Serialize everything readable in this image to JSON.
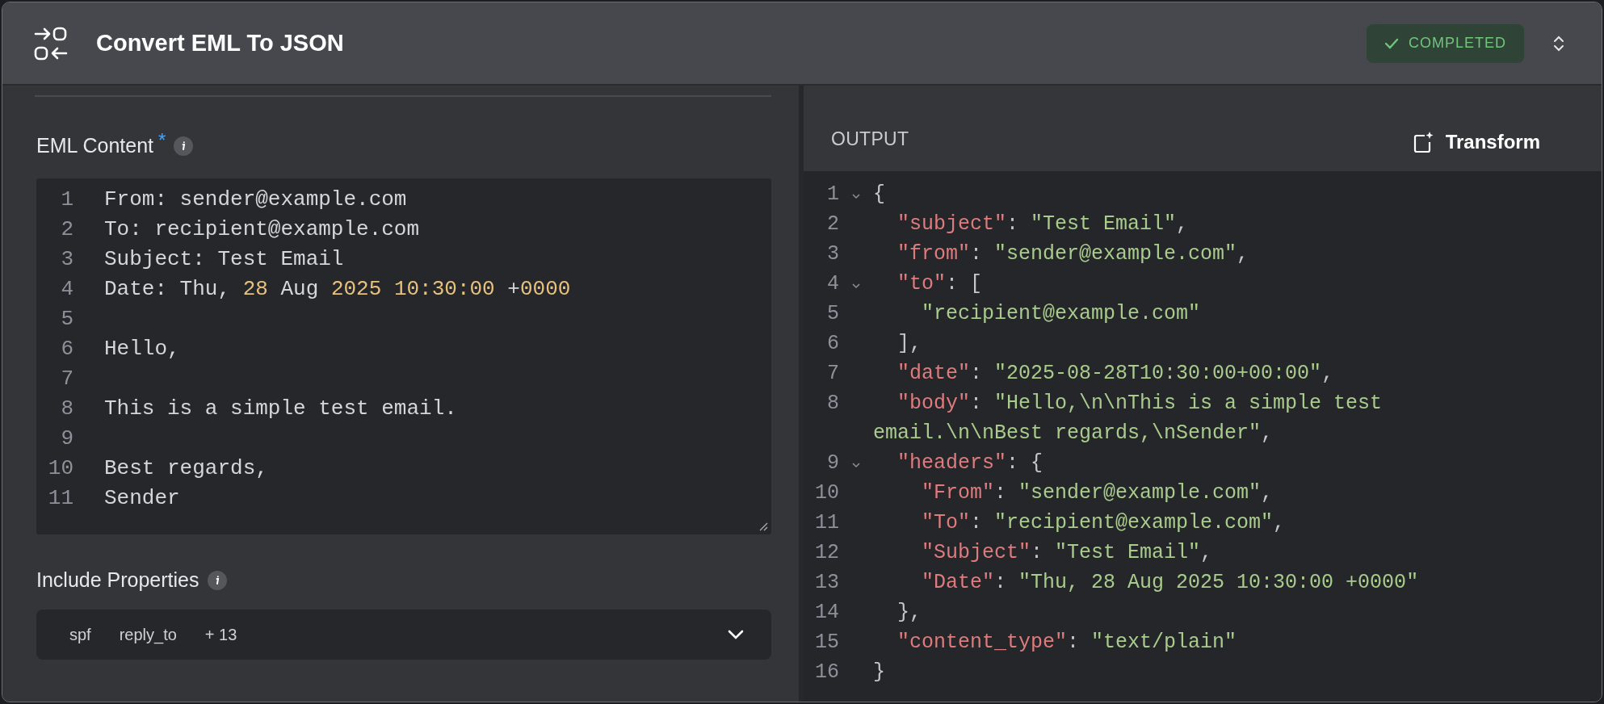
{
  "header": {
    "title": "Convert EML To JSON",
    "status": {
      "label": "COMPLETED"
    }
  },
  "input_panel": {
    "fields": [
      {
        "kind": "code",
        "label": "EML Content",
        "required_mark": "*",
        "lines": [
          {
            "number": "1",
            "segments": [
              {
                "kind": "plain",
                "text": "From: sender@example.com"
              }
            ]
          },
          {
            "number": "2",
            "segments": [
              {
                "kind": "plain",
                "text": "To: recipient@example.com"
              }
            ]
          },
          {
            "number": "3",
            "segments": [
              {
                "kind": "plain",
                "text": "Subject: Test Email"
              }
            ]
          },
          {
            "number": "4",
            "segments": [
              {
                "kind": "plain",
                "text": "Date: Thu, "
              },
              {
                "kind": "number",
                "text": "28"
              },
              {
                "kind": "plain",
                "text": " Aug "
              },
              {
                "kind": "number",
                "text": "2025 10:30:00"
              },
              {
                "kind": "plain",
                "text": " +"
              },
              {
                "kind": "number",
                "text": "0000"
              }
            ]
          },
          {
            "number": "5"
          },
          {
            "number": "6",
            "segments": [
              {
                "kind": "plain",
                "text": "Hello,"
              }
            ]
          },
          {
            "number": "7"
          },
          {
            "number": "8",
            "segments": [
              {
                "kind": "plain",
                "text": "This is a simple test email."
              }
            ]
          },
          {
            "number": "9"
          },
          {
            "number": "10",
            "segments": [
              {
                "kind": "plain",
                "text": "Best regards,"
              }
            ]
          },
          {
            "number": "11",
            "segments": [
              {
                "kind": "plain",
                "text": "Sender"
              }
            ]
          }
        ]
      },
      {
        "kind": "multiselect",
        "label": "Include Properties",
        "chips": [
          "spf",
          "reply_to"
        ],
        "more": "+ 13"
      }
    ]
  },
  "output_panel": {
    "title": "OUTPUT",
    "action": "Transform",
    "lines": [
      {
        "number": "1",
        "foldable": true,
        "segments": [
          {
            "kind": "punct",
            "text": "{"
          }
        ]
      },
      {
        "number": "2",
        "foldable": false,
        "segments": [
          {
            "kind": "key",
            "text": "  \"subject\""
          },
          {
            "kind": "punct",
            "text": ": "
          },
          {
            "kind": "string",
            "text": "\"Test Email\""
          },
          {
            "kind": "punct",
            "text": ","
          }
        ]
      },
      {
        "number": "3",
        "foldable": false,
        "segments": [
          {
            "kind": "key",
            "text": "  \"from\""
          },
          {
            "kind": "punct",
            "text": ": "
          },
          {
            "kind": "string",
            "text": "\"sender@example.com\""
          },
          {
            "kind": "punct",
            "text": ","
          }
        ]
      },
      {
        "number": "4",
        "foldable": true,
        "segments": [
          {
            "kind": "key",
            "text": "  \"to\""
          },
          {
            "kind": "punct",
            "text": ": ["
          }
        ]
      },
      {
        "number": "5",
        "foldable": false,
        "segments": [
          {
            "kind": "string",
            "text": "    \"recipient@example.com\""
          }
        ]
      },
      {
        "number": "6",
        "foldable": false,
        "segments": [
          {
            "kind": "punct",
            "text": "  ],"
          }
        ]
      },
      {
        "number": "7",
        "foldable": false,
        "segments": [
          {
            "kind": "key",
            "text": "  \"date\""
          },
          {
            "kind": "punct",
            "text": ": "
          },
          {
            "kind": "string",
            "text": "\"2025-08-28T10:30:00+00:00\""
          },
          {
            "kind": "punct",
            "text": ","
          }
        ]
      },
      {
        "number": "8",
        "foldable": false,
        "segments": [
          {
            "kind": "key",
            "text": "  \"body\""
          },
          {
            "kind": "punct",
            "text": ": "
          },
          {
            "kind": "string",
            "text": "\"Hello,\\n\\nThis is a simple test email.\\n\\nBest regards,\\nSender\""
          },
          {
            "kind": "punct",
            "text": ","
          }
        ]
      },
      {
        "number": "9",
        "foldable": true,
        "segments": [
          {
            "kind": "key",
            "text": "  \"headers\""
          },
          {
            "kind": "punct",
            "text": ": {"
          }
        ]
      },
      {
        "number": "10",
        "foldable": false,
        "segments": [
          {
            "kind": "key",
            "text": "    \"From\""
          },
          {
            "kind": "punct",
            "text": ": "
          },
          {
            "kind": "string",
            "text": "\"sender@example.com\""
          },
          {
            "kind": "punct",
            "text": ","
          }
        ]
      },
      {
        "number": "11",
        "foldable": false,
        "segments": [
          {
            "kind": "key",
            "text": "    \"To\""
          },
          {
            "kind": "punct",
            "text": ": "
          },
          {
            "kind": "string",
            "text": "\"recipient@example.com\""
          },
          {
            "kind": "punct",
            "text": ","
          }
        ]
      },
      {
        "number": "12",
        "foldable": false,
        "segments": [
          {
            "kind": "key",
            "text": "    \"Subject\""
          },
          {
            "kind": "punct",
            "text": ": "
          },
          {
            "kind": "string",
            "text": "\"Test Email\""
          },
          {
            "kind": "punct",
            "text": ","
          }
        ]
      },
      {
        "number": "13",
        "foldable": false,
        "segments": [
          {
            "kind": "key",
            "text": "    \"Date\""
          },
          {
            "kind": "punct",
            "text": ": "
          },
          {
            "kind": "string",
            "text": "\"Thu, 28 Aug 2025 10:30:00 +0000\""
          }
        ]
      },
      {
        "number": "14",
        "foldable": false,
        "segments": [
          {
            "kind": "punct",
            "text": "  },"
          }
        ]
      },
      {
        "number": "15",
        "foldable": false,
        "segments": [
          {
            "kind": "key",
            "text": "  \"content_type\""
          },
          {
            "kind": "punct",
            "text": ": "
          },
          {
            "kind": "string",
            "text": "\"text/plain\""
          }
        ]
      },
      {
        "number": "16",
        "foldable": false,
        "segments": [
          {
            "kind": "punct",
            "text": "}"
          }
        ]
      }
    ]
  }
}
